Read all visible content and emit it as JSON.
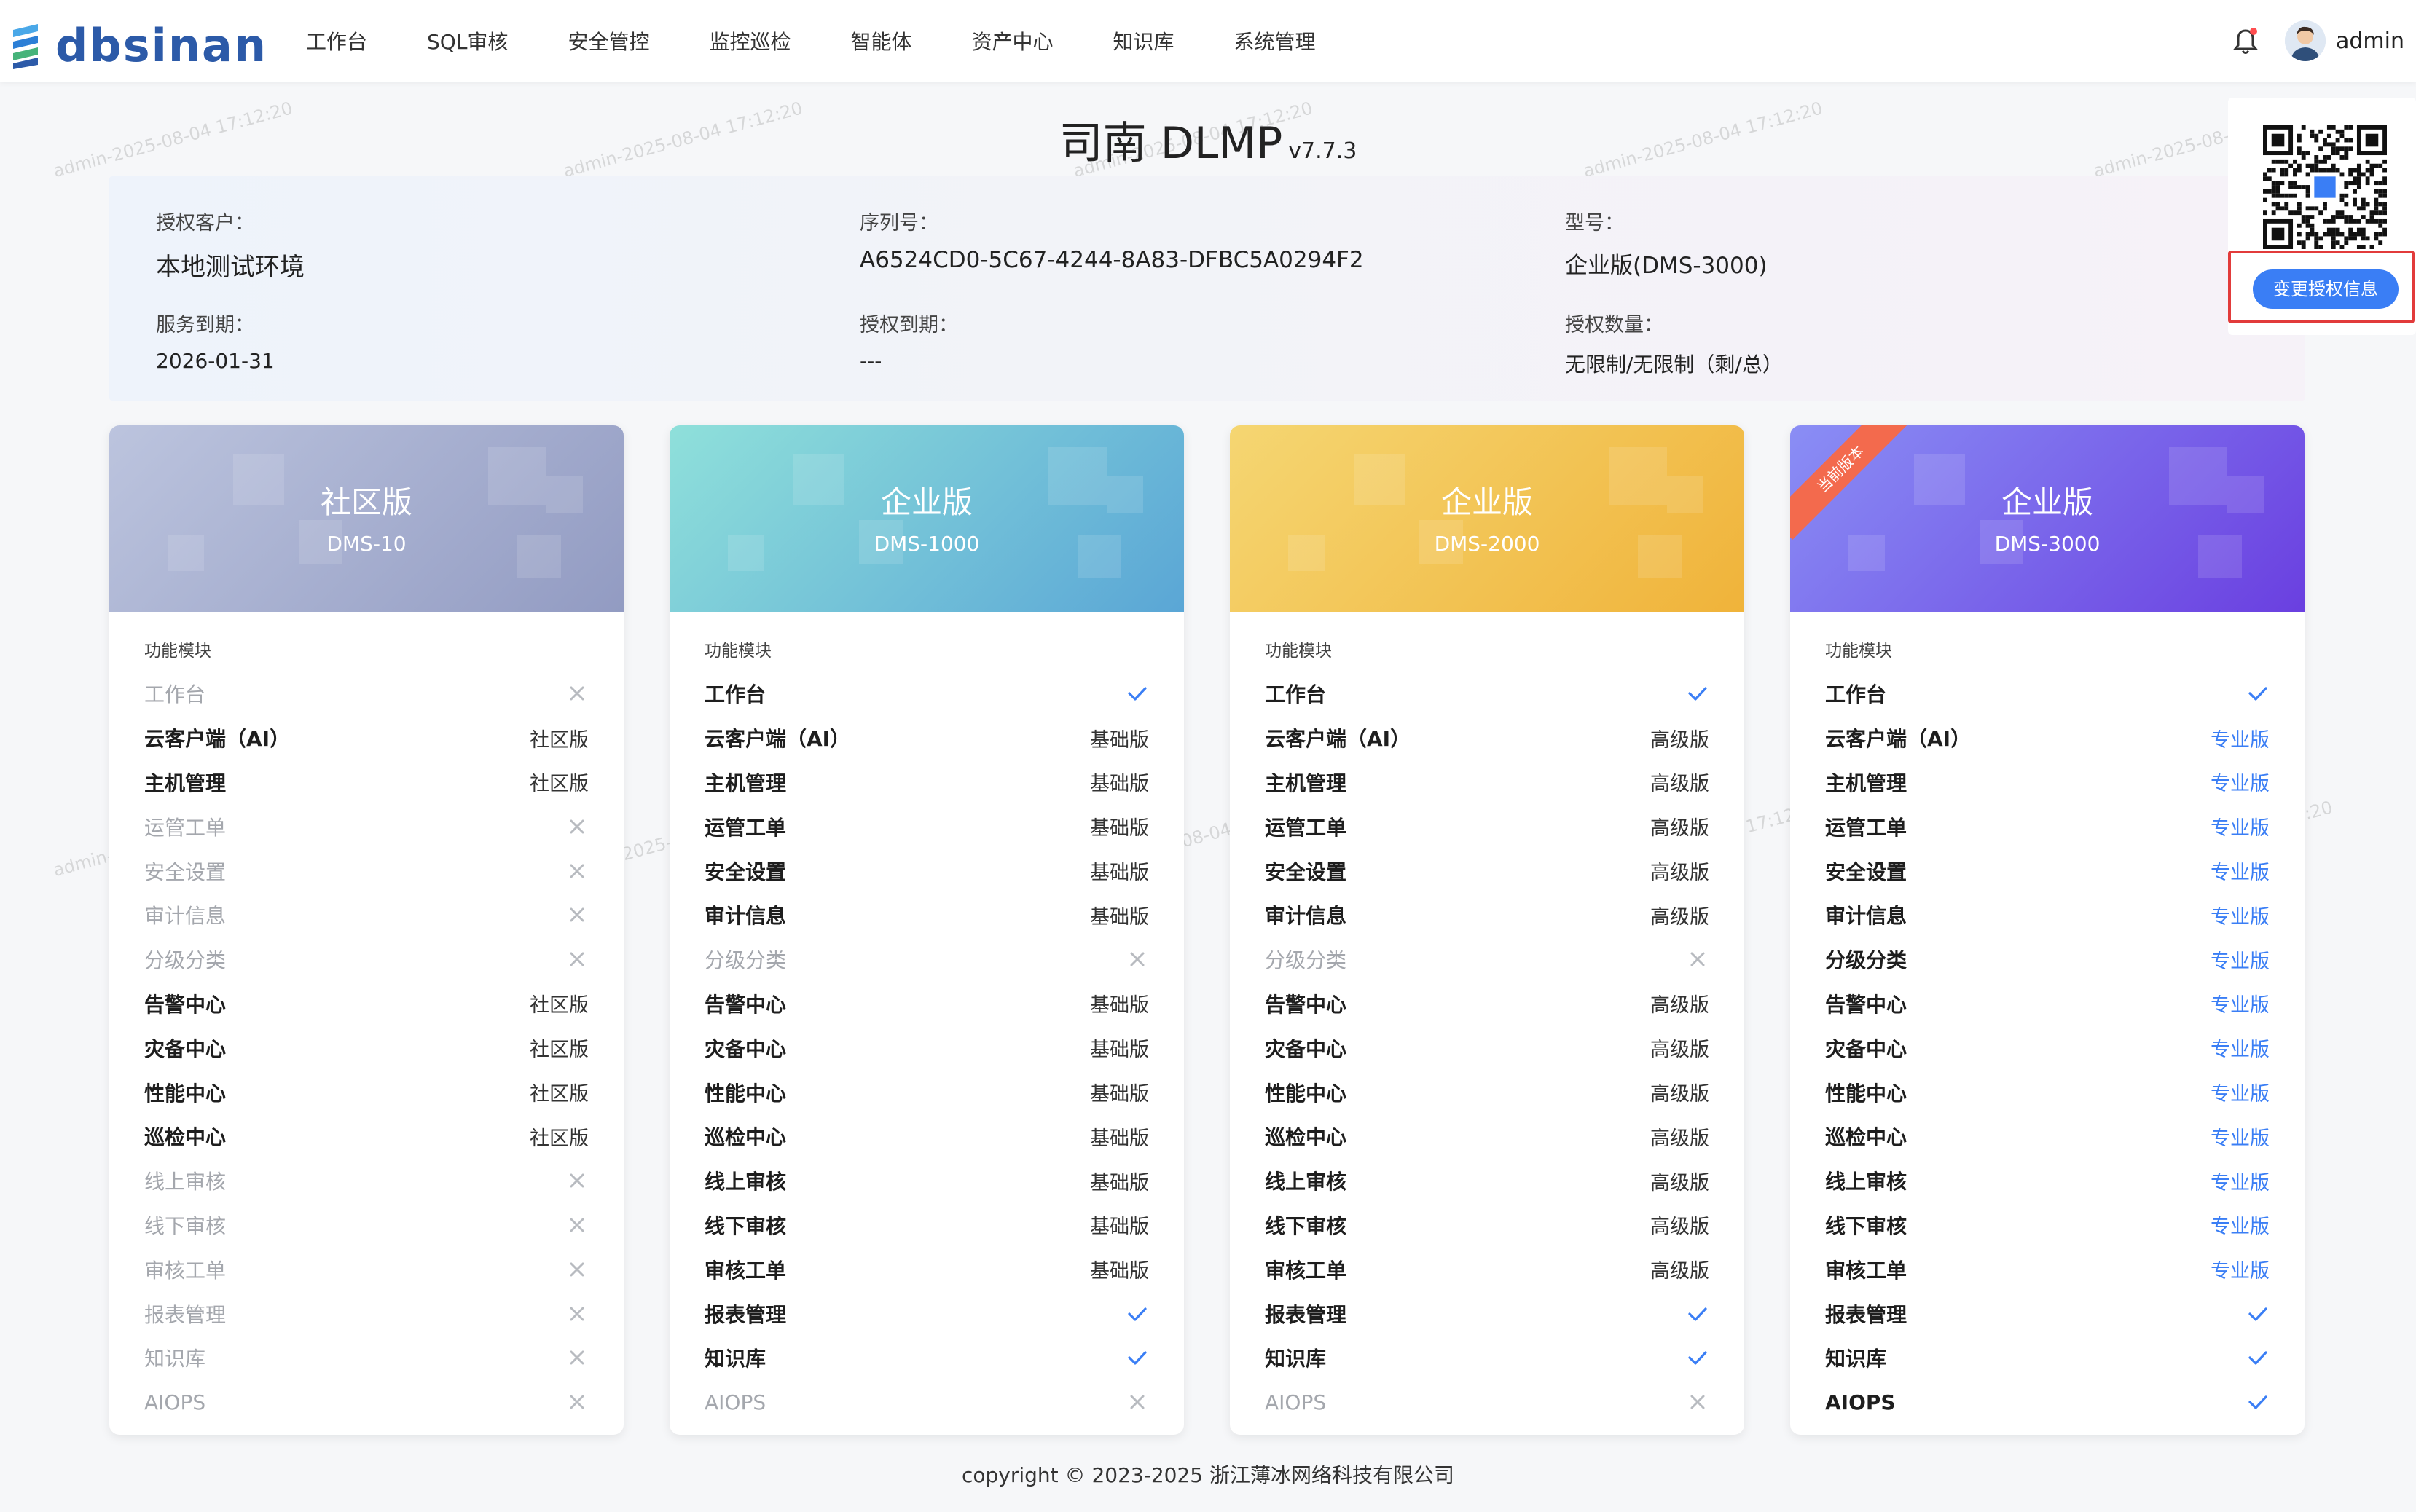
{
  "header": {
    "logo_text": "dbsinan",
    "nav": [
      "工作台",
      "SQL审核",
      "安全管控",
      "监控巡检",
      "智能体",
      "资产中心",
      "知识库",
      "系统管理"
    ],
    "user": "admin"
  },
  "watermark_text": "admin-2025-08-04 17:12:20",
  "title": {
    "main": "司南 DLMP",
    "version": "v7.7.3"
  },
  "license": {
    "customer_label": "授权客户：",
    "customer_value": "本地测试环境",
    "serial_label": "序列号：",
    "serial_value": "A6524CD0-5C67-4244-8A83-DFBC5A0294F2",
    "model_label": "型号：",
    "model_value": "企业版(DMS-3000)",
    "service_label": "服务到期：",
    "service_value": "2026-01-31",
    "auth_expire_label": "授权到期：",
    "auth_expire_value": "---",
    "count_label": "授权数量：",
    "count_value": "无限制/无限制（剩/总）",
    "change_button": "变更授权信息"
  },
  "feature_section_label": "功能模块",
  "current_ribbon": "当前版本",
  "editions": [
    {
      "name": "社区版",
      "model": "DMS-10",
      "features": [
        {
          "name": "工作台",
          "status": "x",
          "value": ""
        },
        {
          "name": "云客户端（AI）",
          "status": "text",
          "value": "社区版"
        },
        {
          "name": "主机管理",
          "status": "text",
          "value": "社区版"
        },
        {
          "name": "运管工单",
          "status": "x",
          "value": ""
        },
        {
          "name": "安全设置",
          "status": "x",
          "value": ""
        },
        {
          "name": "审计信息",
          "status": "x",
          "value": ""
        },
        {
          "name": "分级分类",
          "status": "x",
          "value": ""
        },
        {
          "name": "告警中心",
          "status": "text",
          "value": "社区版"
        },
        {
          "name": "灾备中心",
          "status": "text",
          "value": "社区版"
        },
        {
          "name": "性能中心",
          "status": "text",
          "value": "社区版"
        },
        {
          "name": "巡检中心",
          "status": "text",
          "value": "社区版"
        },
        {
          "name": "线上审核",
          "status": "x",
          "value": ""
        },
        {
          "name": "线下审核",
          "status": "x",
          "value": ""
        },
        {
          "name": "审核工单",
          "status": "x",
          "value": ""
        },
        {
          "name": "报表管理",
          "status": "x",
          "value": ""
        },
        {
          "name": "知识库",
          "status": "x",
          "value": ""
        },
        {
          "name": "AIOPS",
          "status": "x",
          "value": ""
        }
      ]
    },
    {
      "name": "企业版",
      "model": "DMS-1000",
      "features": [
        {
          "name": "工作台",
          "status": "check",
          "value": ""
        },
        {
          "name": "云客户端（AI）",
          "status": "text",
          "value": "基础版"
        },
        {
          "name": "主机管理",
          "status": "text",
          "value": "基础版"
        },
        {
          "name": "运管工单",
          "status": "text",
          "value": "基础版"
        },
        {
          "name": "安全设置",
          "status": "text",
          "value": "基础版"
        },
        {
          "name": "审计信息",
          "status": "text",
          "value": "基础版"
        },
        {
          "name": "分级分类",
          "status": "x",
          "value": ""
        },
        {
          "name": "告警中心",
          "status": "text",
          "value": "基础版"
        },
        {
          "name": "灾备中心",
          "status": "text",
          "value": "基础版"
        },
        {
          "name": "性能中心",
          "status": "text",
          "value": "基础版"
        },
        {
          "name": "巡检中心",
          "status": "text",
          "value": "基础版"
        },
        {
          "name": "线上审核",
          "status": "text",
          "value": "基础版"
        },
        {
          "name": "线下审核",
          "status": "text",
          "value": "基础版"
        },
        {
          "name": "审核工单",
          "status": "text",
          "value": "基础版"
        },
        {
          "name": "报表管理",
          "status": "check",
          "value": ""
        },
        {
          "name": "知识库",
          "status": "check",
          "value": ""
        },
        {
          "name": "AIOPS",
          "status": "x",
          "value": ""
        }
      ]
    },
    {
      "name": "企业版",
      "model": "DMS-2000",
      "features": [
        {
          "name": "工作台",
          "status": "check",
          "value": ""
        },
        {
          "name": "云客户端（AI）",
          "status": "text",
          "value": "高级版"
        },
        {
          "name": "主机管理",
          "status": "text",
          "value": "高级版"
        },
        {
          "name": "运管工单",
          "status": "text",
          "value": "高级版"
        },
        {
          "name": "安全设置",
          "status": "text",
          "value": "高级版"
        },
        {
          "name": "审计信息",
          "status": "text",
          "value": "高级版"
        },
        {
          "name": "分级分类",
          "status": "x",
          "value": ""
        },
        {
          "name": "告警中心",
          "status": "text",
          "value": "高级版"
        },
        {
          "name": "灾备中心",
          "status": "text",
          "value": "高级版"
        },
        {
          "name": "性能中心",
          "status": "text",
          "value": "高级版"
        },
        {
          "name": "巡检中心",
          "status": "text",
          "value": "高级版"
        },
        {
          "name": "线上审核",
          "status": "text",
          "value": "高级版"
        },
        {
          "name": "线下审核",
          "status": "text",
          "value": "高级版"
        },
        {
          "name": "审核工单",
          "status": "text",
          "value": "高级版"
        },
        {
          "name": "报表管理",
          "status": "check",
          "value": ""
        },
        {
          "name": "知识库",
          "status": "check",
          "value": ""
        },
        {
          "name": "AIOPS",
          "status": "x",
          "value": ""
        }
      ]
    },
    {
      "name": "企业版",
      "model": "DMS-3000",
      "current": true,
      "features": [
        {
          "name": "工作台",
          "status": "check",
          "value": ""
        },
        {
          "name": "云客户端（AI）",
          "status": "pro",
          "value": "专业版"
        },
        {
          "name": "主机管理",
          "status": "pro",
          "value": "专业版"
        },
        {
          "name": "运管工单",
          "status": "pro",
          "value": "专业版"
        },
        {
          "name": "安全设置",
          "status": "pro",
          "value": "专业版"
        },
        {
          "name": "审计信息",
          "status": "pro",
          "value": "专业版"
        },
        {
          "name": "分级分类",
          "status": "pro",
          "value": "专业版"
        },
        {
          "name": "告警中心",
          "status": "pro",
          "value": "专业版"
        },
        {
          "name": "灾备中心",
          "status": "pro",
          "value": "专业版"
        },
        {
          "name": "性能中心",
          "status": "pro",
          "value": "专业版"
        },
        {
          "name": "巡检中心",
          "status": "pro",
          "value": "专业版"
        },
        {
          "name": "线上审核",
          "status": "pro",
          "value": "专业版"
        },
        {
          "name": "线下审核",
          "status": "pro",
          "value": "专业版"
        },
        {
          "name": "审核工单",
          "status": "pro",
          "value": "专业版"
        },
        {
          "name": "报表管理",
          "status": "check",
          "value": ""
        },
        {
          "name": "知识库",
          "status": "check",
          "value": ""
        },
        {
          "name": "AIOPS",
          "status": "check",
          "value": ""
        }
      ]
    }
  ],
  "icons": {
    "check": "check-icon",
    "x": "close-icon",
    "bell": "bell-icon",
    "avatar": "user-avatar-icon",
    "qr": "qr-code-icon"
  },
  "colors": {
    "brand": "#2c5aa8",
    "accent": "#3a7ef5",
    "check": "#3a7ef5",
    "x": "#b8bbc0",
    "ribbon": "#f36a4d",
    "highlight": "#e23b3b"
  },
  "footer": "copyright © 2023-2025 浙江薄冰网络科技有限公司"
}
